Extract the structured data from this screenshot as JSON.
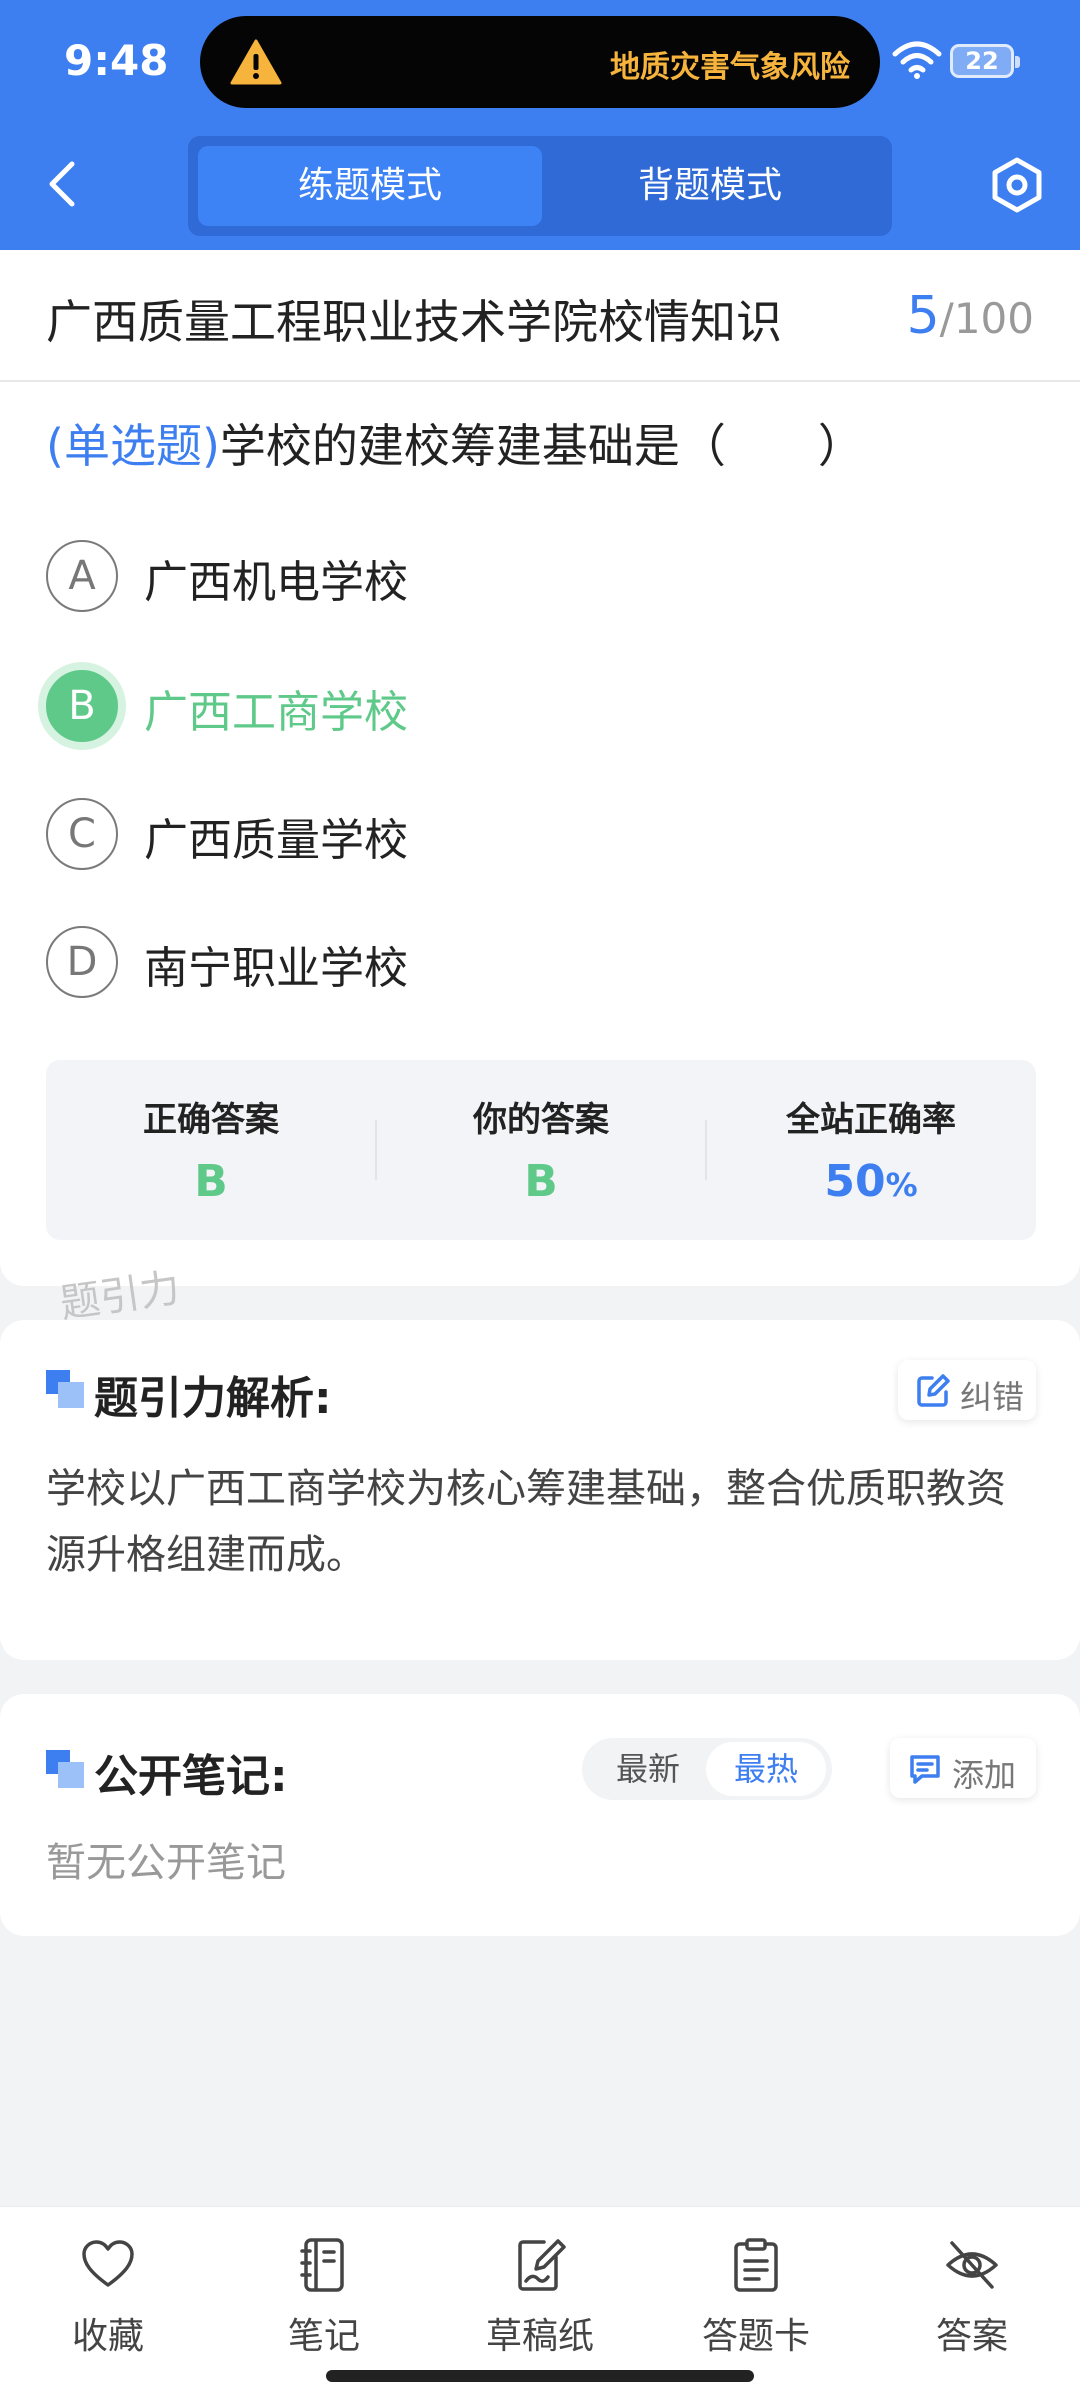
{
  "status": {
    "time": "9:48",
    "alert": "地质灾害气象风险",
    "battery": "22"
  },
  "header": {
    "modes": [
      "练题模式",
      "背题模式"
    ],
    "active_mode": "练题模式"
  },
  "question": {
    "bank_title": "广西质量工程职业技术学院校情知识",
    "progress_current": "5",
    "progress_total": "/100",
    "type": "(单选题)",
    "stem": "学校的建校筹建基础是（　　）",
    "options": [
      {
        "key": "A",
        "text": "广西机电学校"
      },
      {
        "key": "B",
        "text": "广西工商学校"
      },
      {
        "key": "C",
        "text": "广西质量学校"
      },
      {
        "key": "D",
        "text": "南宁职业学校"
      }
    ],
    "selected": "B"
  },
  "answer_summary": {
    "correct_label": "正确答案",
    "correct_value": "B",
    "yours_label": "你的答案",
    "yours_value": "B",
    "rate_label": "全站正确率",
    "rate_value": "50",
    "rate_unit": "%"
  },
  "watermark": "题引力",
  "analysis": {
    "title": "题引力解析:",
    "report_button": "纠错",
    "text": "学校以广西工商学校为核心筹建基础，整合优质职教资源升格组建而成。"
  },
  "notes": {
    "title": "公开笔记:",
    "sort_options": [
      "最新",
      "最热"
    ],
    "active_sort": "最热",
    "add_button": "添加",
    "empty_text": "暂无公开笔记"
  },
  "toolbar": {
    "items": [
      {
        "label": "收藏",
        "icon": "heart-icon"
      },
      {
        "label": "笔记",
        "icon": "notebook-icon"
      },
      {
        "label": "草稿纸",
        "icon": "draft-icon"
      },
      {
        "label": "答题卡",
        "icon": "answer-card-icon"
      },
      {
        "label": "答案",
        "icon": "eye-off-icon"
      }
    ]
  },
  "colors": {
    "primary": "#3d7ef0",
    "correct": "#5fc98a",
    "alert": "#f6b43c"
  }
}
